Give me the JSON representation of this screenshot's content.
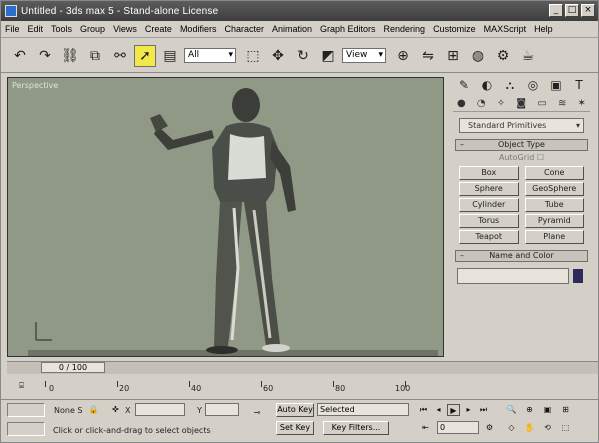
{
  "window": {
    "title": "Untitled - 3ds max 5 - Stand-alone License",
    "min": "_",
    "max": "□",
    "close": "×"
  },
  "menu": [
    "File",
    "Edit",
    "Tools",
    "Group",
    "Views",
    "Create",
    "Modifiers",
    "Character",
    "Animation",
    "Graph Editors",
    "Rendering",
    "Customize",
    "MAXScript",
    "Help"
  ],
  "toolbar": {
    "selection_filter": "All",
    "ref_coord": "View"
  },
  "viewport": {
    "label": "Perspective"
  },
  "command_panel": {
    "dropdown": "Standard Primitives",
    "object_type_title": "Object Type",
    "autogrid": "AutoGrid",
    "buttons": [
      "Box",
      "Cone",
      "Sphere",
      "GeoSphere",
      "Cylinder",
      "Tube",
      "Torus",
      "Pyramid",
      "Teapot",
      "Plane"
    ],
    "name_color_title": "Name and Color"
  },
  "timeline": {
    "frame": "0 / 100",
    "ticks": [
      "0",
      "20",
      "40",
      "60",
      "80",
      "100"
    ]
  },
  "status": {
    "none_selected": "None S",
    "x_label": "X",
    "y_label": "Y",
    "prompt": "Click or click-and-drag to select objects",
    "auto_key": "Auto Key",
    "set_key": "Set Key",
    "selected": "Selected",
    "key_filters": "Key Filters...",
    "frame_field": "0"
  }
}
